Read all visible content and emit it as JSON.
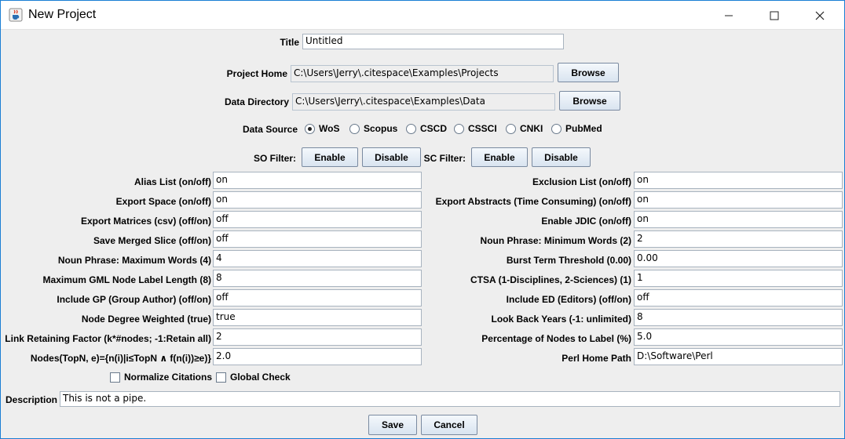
{
  "window": {
    "title": "New Project"
  },
  "form": {
    "title_label": "Title",
    "title_value": "Untitled",
    "project_home_label": "Project Home",
    "project_home_value": "C:\\Users\\Jerry\\.citespace\\Examples\\Projects",
    "data_directory_label": "Data Directory",
    "data_directory_value": "C:\\Users\\Jerry\\.citespace\\Examples\\Data",
    "browse_label": "Browse",
    "data_source_label": "Data Source",
    "data_sources": [
      "WoS",
      "Scopus",
      "CSCD",
      "CSSCI",
      "CNKI",
      "PubMed"
    ],
    "selected_source": "WoS",
    "so_filter_label": "SO Filter:",
    "sc_filter_label": "SC Filter:",
    "enable_label": "Enable",
    "disable_label": "Disable"
  },
  "left_params": [
    {
      "label": "Alias List (on/off)",
      "value": "on"
    },
    {
      "label": "Export Space (on/off)",
      "value": "on"
    },
    {
      "label": "Export Matrices (csv) (off/on)",
      "value": "off"
    },
    {
      "label": "Save Merged Slice (off/on)",
      "value": "off"
    },
    {
      "label": "Noun Phrase: Maximum Words (4)",
      "value": "4"
    },
    {
      "label": "Maximum GML Node Label Length (8)",
      "value": "8"
    },
    {
      "label": "Include GP (Group Author) (off/on)",
      "value": "off"
    },
    {
      "label": "Node Degree Weighted (true)",
      "value": "true"
    },
    {
      "label": "Link Retaining Factor (k*#nodes; -1:Retain all)",
      "value": "2"
    },
    {
      "label": "Nodes(TopN, e)={n(i)|i≤TopN ∧ f(n(i))≥e)}",
      "value": "2.0"
    }
  ],
  "right_params": [
    {
      "label": "Exclusion List (on/off)",
      "value": "on"
    },
    {
      "label": "Export Abstracts (Time Consuming) (on/off)",
      "value": "on"
    },
    {
      "label": "Enable JDIC (on/off)",
      "value": "on"
    },
    {
      "label": "Noun Phrase: Minimum Words (2)",
      "value": "2"
    },
    {
      "label": "Burst Term Threshold (0.00)",
      "value": "0.00"
    },
    {
      "label": "CTSA (1-Disciplines, 2-Sciences) (1)",
      "value": "1"
    },
    {
      "label": "Include ED (Editors) (off/on)",
      "value": "off"
    },
    {
      "label": "Look Back Years (-1: unlimited)",
      "value": "8"
    },
    {
      "label": "Percentage of Nodes to Label (%)",
      "value": "5.0"
    },
    {
      "label": "Perl Home Path",
      "value": "D:\\Software\\Perl"
    }
  ],
  "checks": {
    "normalize_label": "Normalize Citations",
    "global_label": "Global Check"
  },
  "description": {
    "label": "Description",
    "value": "This is not a pipe."
  },
  "footer": {
    "save_label": "Save",
    "cancel_label": "Cancel"
  }
}
